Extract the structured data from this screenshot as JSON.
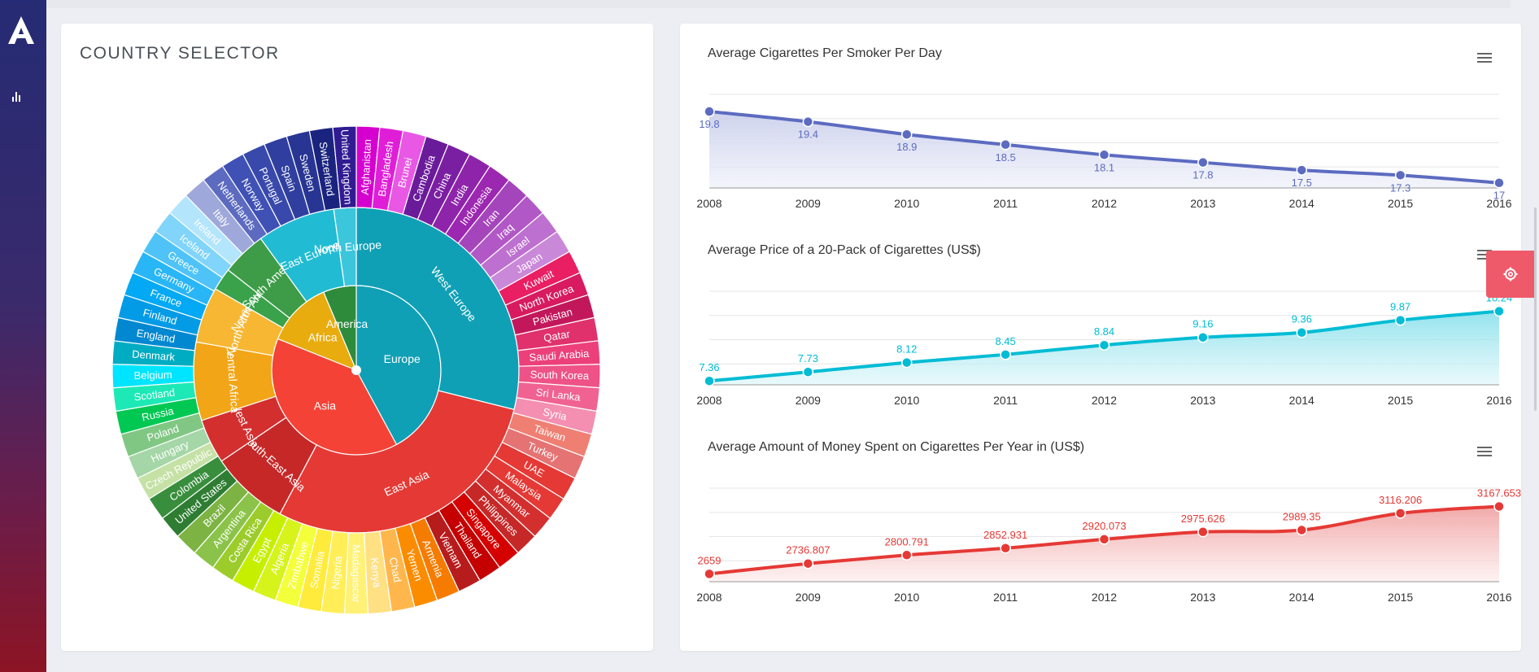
{
  "app": {
    "logo_icon": "brand-a-logo-icon",
    "nav_icon": "bar-chart-icon",
    "settings_icon": "gear-icon"
  },
  "country_selector": {
    "title": "COUNTRY SELECTOR",
    "center": [
      {
        "label": "Europe",
        "value": 40,
        "color": "#0fa0b6"
      },
      {
        "label": "Asia",
        "value": 37,
        "color": "#f44336"
      },
      {
        "label": "Africa",
        "value": 12,
        "color": "#e8ac0f"
      },
      {
        "label": "America",
        "value": 6,
        "color": "#2e8b3c"
      }
    ],
    "regions": [
      {
        "label": "West Europe",
        "value": 26,
        "color": "#0fa0b6"
      },
      {
        "label": "East Asia",
        "value": 26,
        "color": "#e53935"
      },
      {
        "label": "South-East Asia",
        "value": 7,
        "color": "#c62828"
      },
      {
        "label": "West Asia",
        "value": 4,
        "color": "#d32f2f"
      },
      {
        "label": "Central Africa",
        "value": 7,
        "color": "#f2a516"
      },
      {
        "label": "North Africa",
        "value": 5,
        "color": "#f7b733"
      },
      {
        "label": "North America",
        "value": 2,
        "color": "#3aa24a"
      },
      {
        "label": "South America",
        "value": 4,
        "color": "#3e9c48"
      },
      {
        "label": "East Europe",
        "value": 7,
        "color": "#21bcd3"
      },
      {
        "label": "North Europe",
        "value": 2,
        "color": "#3cc6dc"
      }
    ],
    "countries": [
      {
        "label": "Afghanistan",
        "color": "#d500d0"
      },
      {
        "label": "Bangladesh",
        "color": "#e01ed8"
      },
      {
        "label": "Brunei",
        "color": "#e858e4"
      },
      {
        "label": "Cambodia",
        "color": "#6a1b9a"
      },
      {
        "label": "China",
        "color": "#7b1fa2"
      },
      {
        "label": "India",
        "color": "#8e24aa"
      },
      {
        "label": "Indonesia",
        "color": "#9c27b0"
      },
      {
        "label": "Iran",
        "color": "#a545bb"
      },
      {
        "label": "Iraq",
        "color": "#b158c6"
      },
      {
        "label": "Israel",
        "color": "#bd70cf"
      },
      {
        "label": "Japan",
        "color": "#ca88d9"
      },
      {
        "label": "Kuwait",
        "color": "#e91e63"
      },
      {
        "label": "North Korea",
        "color": "#d81b60"
      },
      {
        "label": "Pakistan",
        "color": "#c2185b"
      },
      {
        "label": "Qatar",
        "color": "#e0316d"
      },
      {
        "label": "Saudi Arabia",
        "color": "#ec407a"
      },
      {
        "label": "South Korea",
        "color": "#ee5287"
      },
      {
        "label": "Sri Lanka",
        "color": "#f06292"
      },
      {
        "label": "Syria",
        "color": "#f48fb1"
      },
      {
        "label": "Taiwan",
        "color": "#ef7f72"
      },
      {
        "label": "Turkey",
        "color": "#e57373"
      },
      {
        "label": "UAE",
        "color": "#e53935"
      },
      {
        "label": "Malaysia",
        "color": "#e53935"
      },
      {
        "label": "Myanmar",
        "color": "#d32f2f"
      },
      {
        "label": "Philippines",
        "color": "#c62828"
      },
      {
        "label": "Singapore",
        "color": "#d50000"
      },
      {
        "label": "Thailand",
        "color": "#c40000"
      },
      {
        "label": "Vietnam",
        "color": "#b71c1c"
      },
      {
        "label": "Armenia",
        "color": "#f57c00"
      },
      {
        "label": "Yemen",
        "color": "#fb8c00"
      },
      {
        "label": "Chad",
        "color": "#ffb74d"
      },
      {
        "label": "Kenya",
        "color": "#ffe082"
      },
      {
        "label": "Madagascar",
        "color": "#fff176"
      },
      {
        "label": "Nigeria",
        "color": "#ffee58"
      },
      {
        "label": "Somalia",
        "color": "#ffeb3b"
      },
      {
        "label": "Zimbabwe",
        "color": "#f4ff3c"
      },
      {
        "label": "Algeria",
        "color": "#d6f31c"
      },
      {
        "label": "Egypt",
        "color": "#c6ef00"
      },
      {
        "label": "Costa Rica",
        "color": "#9ccc2c"
      },
      {
        "label": "Argentina",
        "color": "#8bc34a"
      },
      {
        "label": "Brazil",
        "color": "#7cb342"
      },
      {
        "label": "United States",
        "color": "#2e7d32"
      },
      {
        "label": "Colombia",
        "color": "#388e3c"
      },
      {
        "label": "Czech Republic",
        "color": "#c5e1a5"
      },
      {
        "label": "Hungary",
        "color": "#a5d6a7"
      },
      {
        "label": "Poland",
        "color": "#81c784"
      },
      {
        "label": "Russia",
        "color": "#00c853"
      },
      {
        "label": "Scotland",
        "color": "#1de9b6"
      },
      {
        "label": "Belgium",
        "color": "#00e5ff"
      },
      {
        "label": "Denmark",
        "color": "#00acc1"
      },
      {
        "label": "England",
        "color": "#0288d1"
      },
      {
        "label": "Finland",
        "color": "#039be5"
      },
      {
        "label": "France",
        "color": "#03a9f4"
      },
      {
        "label": "Germany",
        "color": "#29b6f6"
      },
      {
        "label": "Greece",
        "color": "#4fc3f7"
      },
      {
        "label": "Iceland",
        "color": "#81d4fa"
      },
      {
        "label": "Ireland",
        "color": "#b3e5fc"
      },
      {
        "label": "Italy",
        "color": "#9fa8da"
      },
      {
        "label": "Netherlands",
        "color": "#5c6bc0"
      },
      {
        "label": "Norway",
        "color": "#3f51b5"
      },
      {
        "label": "Portugal",
        "color": "#3949ab"
      },
      {
        "label": "Spain",
        "color": "#303f9f"
      },
      {
        "label": "Sweden",
        "color": "#283593"
      },
      {
        "label": "Switzerland",
        "color": "#1a237e"
      },
      {
        "label": "United Kingdom",
        "color": "#311b92"
      }
    ]
  },
  "chart_data": [
    {
      "type": "area",
      "title": "Average Cigarettes Per Smoker Per Day",
      "x": [
        "2008",
        "2009",
        "2010",
        "2011",
        "2012",
        "2013",
        "2014",
        "2015",
        "2016"
      ],
      "values": [
        19.8,
        19.4,
        18.9,
        18.5,
        18.1,
        17.8,
        17.5,
        17.3,
        17
      ],
      "labels": [
        "19.8",
        "19.4",
        "18.9",
        "18.5",
        "18.1",
        "17.8",
        "17.5",
        "17.3",
        "17"
      ],
      "label_position": "below",
      "ylim": [
        16.8,
        20.6
      ],
      "color": "#5c6bc0",
      "fill_top": "#c5cae9",
      "fill_bottom": "#eef0fa",
      "menu_icon": "hamburger-menu-icon"
    },
    {
      "type": "area",
      "title": "Average Price of a 20-Pack of Cigarettes (US$)",
      "x": [
        "2008",
        "2009",
        "2010",
        "2011",
        "2012",
        "2013",
        "2014",
        "2015",
        "2016"
      ],
      "values": [
        7.36,
        7.73,
        8.12,
        8.45,
        8.84,
        9.16,
        9.36,
        9.87,
        10.24
      ],
      "labels": [
        "7.36",
        "7.73",
        "8.12",
        "8.45",
        "8.84",
        "9.16",
        "9.36",
        "9.87",
        "10.24"
      ],
      "label_position": "above",
      "ylim": [
        7.2,
        11.2
      ],
      "color": "#00bcd4",
      "fill_top": "#80deea",
      "fill_bottom": "#e0f7fa",
      "menu_icon": "hamburger-menu-icon"
    },
    {
      "type": "area",
      "title": "Average Amount of Money Spent on Cigarettes Per Year in (US$)",
      "x": [
        "2008",
        "2009",
        "2010",
        "2011",
        "2012",
        "2013",
        "2014",
        "2015",
        "2016"
      ],
      "values": [
        2659,
        2736.807,
        2800.791,
        2852.931,
        2920.073,
        2975.626,
        2989.35,
        3116.206,
        3167.653
      ],
      "labels": [
        "2659",
        "2736.807",
        "2800.791",
        "2852.931",
        "2920.073",
        "2975.626",
        "2989.35",
        "3116.206",
        "3167.653"
      ],
      "label_position": "above",
      "ylim": [
        2600,
        3330
      ],
      "color": "#e53935",
      "fill_top": "#ef9a9a",
      "fill_bottom": "#fdecec",
      "menu_icon": "hamburger-menu-icon"
    }
  ]
}
